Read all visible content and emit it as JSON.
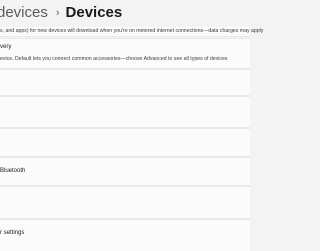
{
  "header": {
    "parent": "devices",
    "separator": "›",
    "current": "Devices"
  },
  "metered": {
    "description": "s, and apps) for new devices will download when you're on metered internet connections—data charges may apply"
  },
  "discovery": {
    "title": "very",
    "description": "evice. Default lets you connect common accessories—choose Advanced to see all types of devices"
  },
  "items": [
    {
      "label": "Bluetooth"
    },
    {
      "label": "r settings"
    }
  ]
}
